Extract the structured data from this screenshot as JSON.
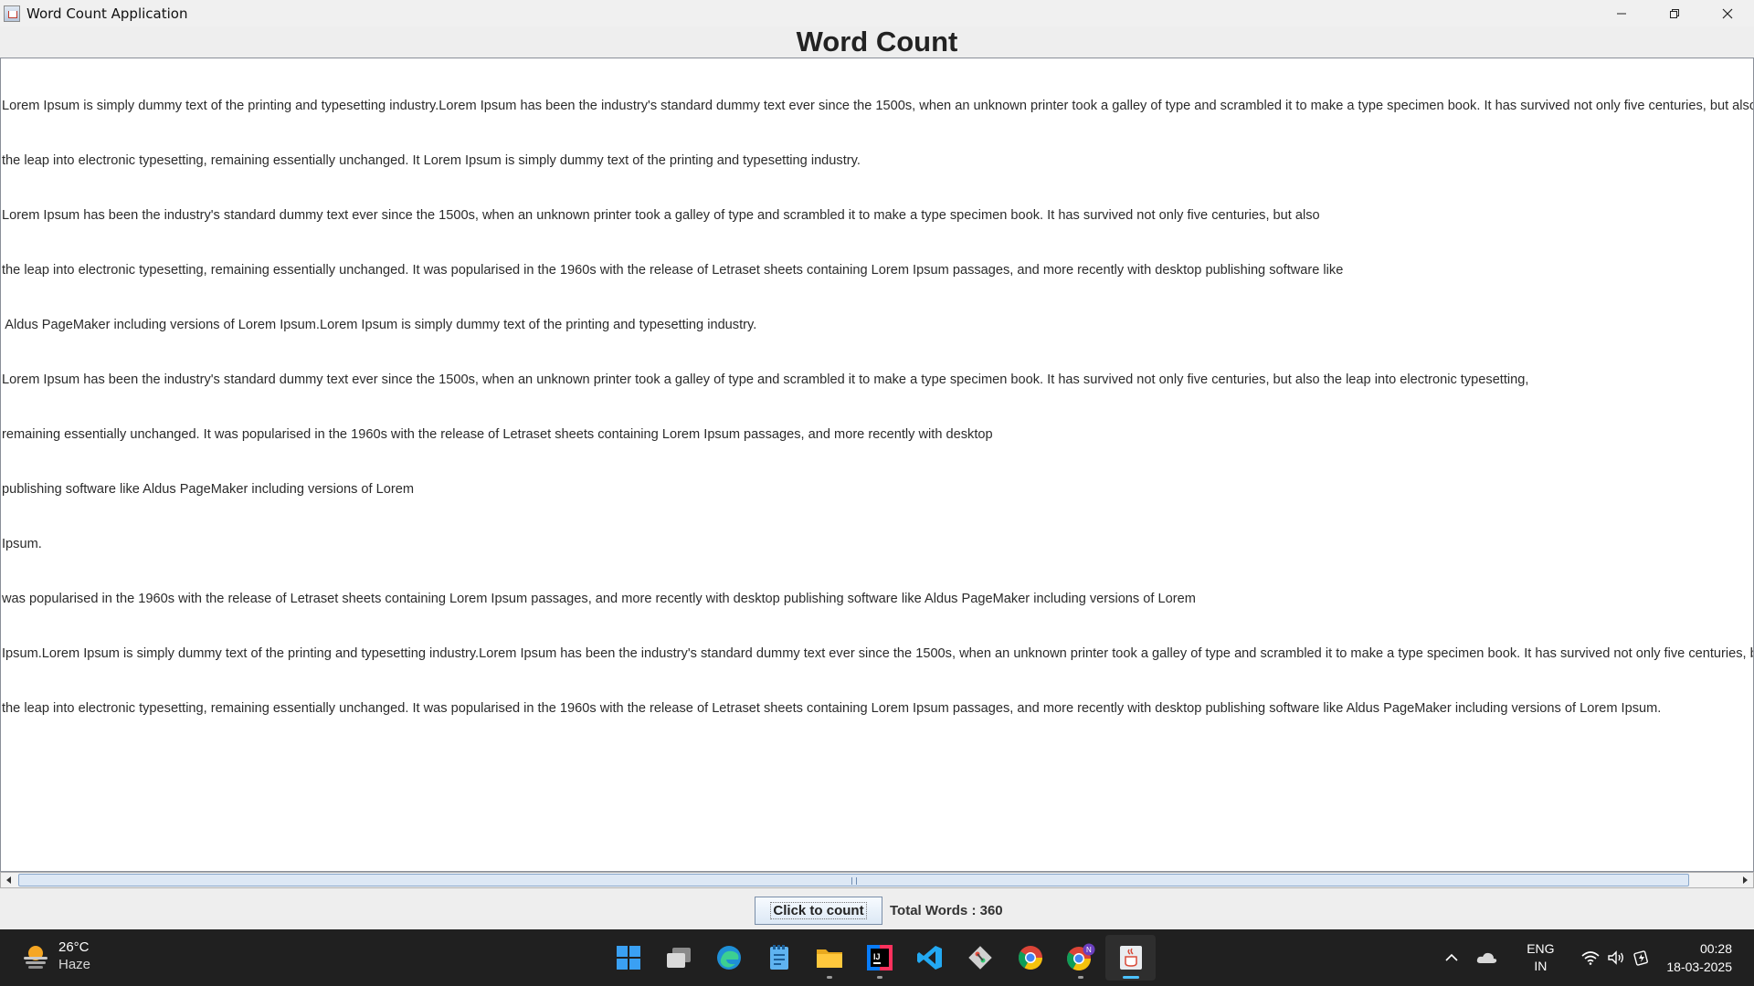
{
  "window": {
    "title": "Word Count Application",
    "controls": [
      "minimize",
      "restore",
      "close"
    ]
  },
  "heading": "Word Count",
  "textarea": {
    "lines": [
      "Lorem Ipsum is simply dummy text of the printing and typesetting industry.Lorem Ipsum has been the industry's standard dummy text ever since the 1500s, when an unknown printer took a galley of type and scrambled it to make a type specimen book. It has survived not only five centuries, but also",
      "the leap into electronic typesetting, remaining essentially unchanged. It Lorem Ipsum is simply dummy text of the printing and typesetting industry.",
      "Lorem Ipsum has been the industry's standard dummy text ever since the 1500s, when an unknown printer took a galley of type and scrambled it to make a type specimen book. It has survived not only five centuries, but also",
      "the leap into electronic typesetting, remaining essentially unchanged. It was popularised in the 1960s with the release of Letraset sheets containing Lorem Ipsum passages, and more recently with desktop publishing software like",
      " Aldus PageMaker including versions of Lorem Ipsum.Lorem Ipsum is simply dummy text of the printing and typesetting industry.",
      "Lorem Ipsum has been the industry's standard dummy text ever since the 1500s, when an unknown printer took a galley of type and scrambled it to make a type specimen book. It has survived not only five centuries, but also the leap into electronic typesetting,",
      "remaining essentially unchanged. It was popularised in the 1960s with the release of Letraset sheets containing Lorem Ipsum passages, and more recently with desktop",
      "publishing software like Aldus PageMaker including versions of Lorem",
      "Ipsum.",
      "was popularised in the 1960s with the release of Letraset sheets containing Lorem Ipsum passages, and more recently with desktop publishing software like Aldus PageMaker including versions of Lorem",
      "Ipsum.Lorem Ipsum is simply dummy text of the printing and typesetting industry.Lorem Ipsum has been the industry's standard dummy text ever since the 1500s, when an unknown printer took a galley of type and scrambled it to make a type specimen book. It has survived not only five centuries, but also",
      "the leap into electronic typesetting, remaining essentially unchanged. It was popularised in the 1960s with the release of Letraset sheets containing Lorem Ipsum passages, and more recently with desktop publishing software like Aldus PageMaker including versions of Lorem Ipsum."
    ]
  },
  "bottom": {
    "count_button": "Click to count",
    "total_words": "Total Words : 360"
  },
  "taskbar": {
    "weather": {
      "temp": "26°C",
      "condition": "Haze",
      "icon": "haze-sun-icon"
    },
    "apps": [
      {
        "name": "start-icon",
        "running": false
      },
      {
        "name": "task-view-icon",
        "running": false
      },
      {
        "name": "edge-icon",
        "running": false
      },
      {
        "name": "notepad-icon",
        "running": false
      },
      {
        "name": "file-explorer-icon",
        "running": true
      },
      {
        "name": "intellij-icon",
        "running": true
      },
      {
        "name": "vscode-icon",
        "running": false
      },
      {
        "name": "git-icon",
        "running": false
      },
      {
        "name": "chrome-icon",
        "running": false
      },
      {
        "name": "chrome-profile-icon",
        "running": true
      },
      {
        "name": "java-icon",
        "running": true,
        "active": true
      }
    ],
    "tray": {
      "lang_line1": "ENG",
      "lang_line2": "IN",
      "time": "00:28",
      "date": "18-03-2025"
    }
  },
  "colors": {
    "accent": "#4cc2ff",
    "taskbar_bg": "#202020",
    "window_bg": "#eeeeee",
    "text": "#2b2b2b"
  }
}
